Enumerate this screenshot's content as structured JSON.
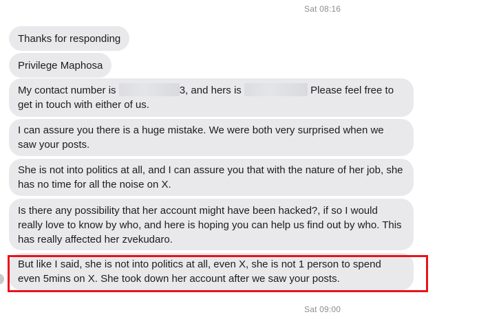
{
  "conversation": {
    "timestamp_top": "Sat 08:16",
    "timestamp_bottom": "Sat 09:00",
    "messages": [
      {
        "text": "Thanks for responding"
      },
      {
        "text": "Privilege Maphosa"
      },
      {
        "text_part1": "My contact number is",
        "text_part2": "3, and hers is",
        "text_part3": "Please feel free to get in touch with either of us."
      },
      {
        "text": "I can assure you there is a huge mistake. We were both very surprised when we saw your posts."
      },
      {
        "text": "She is not into politics at all, and I can assure you that with the nature of her job, she has no time for all the noise on X."
      },
      {
        "text": "Is there any possibility that her account might have been hacked?, if so I would really love to know by who, and here is hoping you can help us find out by who. This has really affected her zvekudaro."
      },
      {
        "text": "But like I said, she is not into politics at all, even X, she is not 1 person to spend even 5mins on X. She took down her account after we saw your posts."
      }
    ],
    "highlight_color": "#e8131b",
    "bubble_color": "#e9e9eb"
  }
}
